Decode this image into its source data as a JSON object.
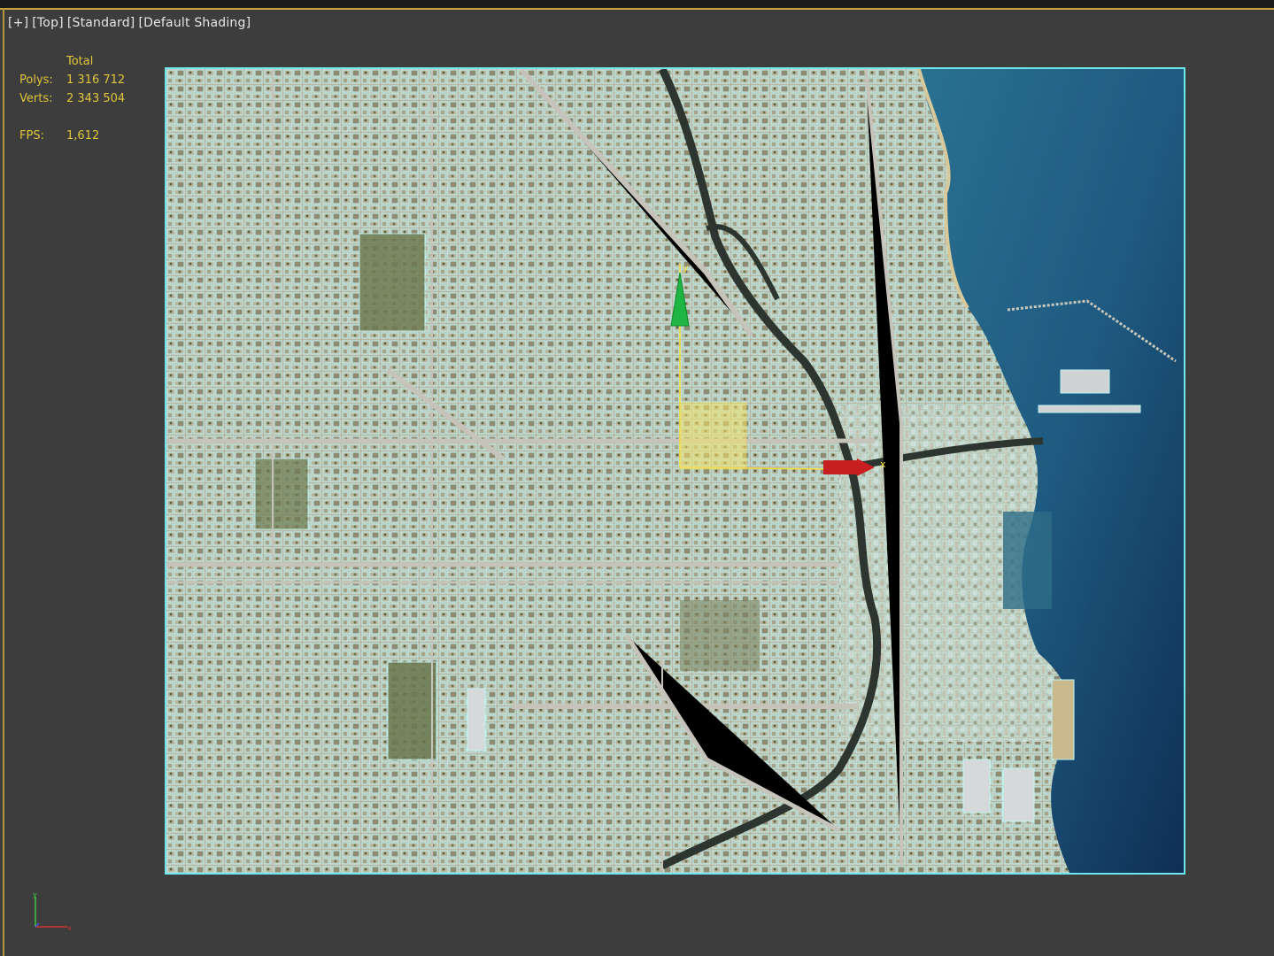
{
  "viewport": {
    "label_items": [
      "[+]",
      "[Top]",
      "[Standard]",
      "[Default Shading]"
    ]
  },
  "stats": {
    "header": "Total",
    "polys_label": "Polys:",
    "polys_value": "1 316 712",
    "verts_label": "Verts:",
    "verts_value": "2 343 504",
    "fps_label": "FPS:",
    "fps_value": "1,612"
  },
  "gizmo": {
    "y_axis_label": "y",
    "x_axis_label": "x"
  },
  "colors": {
    "viewport_bg": "#3d3d3d",
    "active_border": "#c9a640",
    "stats_text": "#e0c63a",
    "selection_wire": "#6fe6ec",
    "water_deep": "#123a5e",
    "water_shallow": "#2a6f8a",
    "land": "#bfc0ad"
  },
  "icons": {
    "tripod": "axis-tripod-icon",
    "pivot": "move-gizmo-icon"
  }
}
